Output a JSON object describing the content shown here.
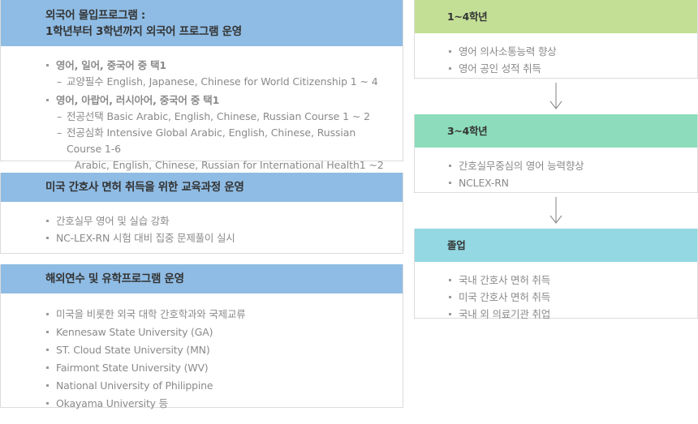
{
  "colors": {
    "left_header_bg": "#8fbce4",
    "grade_1_4_header_bg": "#c3df96",
    "grade_3_4_header_bg": "#8ddcbb",
    "graduation_header_bg": "#93d8e2",
    "body_text": "#8a8a8a",
    "header_text": "#333333",
    "panel_border": "#dcdcdc"
  },
  "left_column": {
    "panels": [
      {
        "title_line_1": "외국어 몰입프로그램 :",
        "title_line_2": "1학년부터 3학년까지 외국어 프로그램 운영",
        "items": [
          {
            "text": "영어, 일어, 중국어 중 택1",
            "bold": true,
            "sub_items": [
              {
                "lines": [
                  "교양필수 English, Japanese, Chinese for World Citizenship 1 ~ 4"
                ]
              }
            ]
          },
          {
            "text": "영어, 아랍어, 러시아어, 중국어 중 택1",
            "bold": true,
            "sub_items": [
              {
                "lines": [
                  "전공선택 Basic Arabic, English, Chinese, Russian Course 1 ~ 2"
                ]
              },
              {
                "lines": [
                  "전공심화 Intensive Global Arabic, English, Chinese, Russian Course 1-6",
                  "Arabic, English, Chinese, Russian for International Health1 ~2"
                ]
              }
            ]
          }
        ]
      },
      {
        "title_line_1": "미국 간호사 면허 취득을 위한 교육과정 운영",
        "title_line_2": "",
        "items": [
          {
            "text": "간호실무 영어 및 실습 강화",
            "bold": false,
            "sub_items": []
          },
          {
            "text": "NC-LEX-RN 시험 대비 집중 문제풀이 실시",
            "bold": false,
            "sub_items": []
          }
        ]
      },
      {
        "title_line_1": "해외연수 및 유학프로그램 운영",
        "title_line_2": "",
        "items": [
          {
            "text": "미국을 비롯한 외국 대학 간호학과와 국제교류",
            "bold": false,
            "sub_items": []
          },
          {
            "text": "Kennesaw State University (GA)",
            "bold": false,
            "sub_items": []
          },
          {
            "text": "ST. Cloud State University (MN)",
            "bold": false,
            "sub_items": []
          },
          {
            "text": "Fairmont State University (WV)",
            "bold": false,
            "sub_items": []
          },
          {
            "text": "National University of Philippine",
            "bold": false,
            "sub_items": []
          },
          {
            "text": "Okayama University 등",
            "bold": false,
            "sub_items": []
          }
        ]
      }
    ]
  },
  "right_column": {
    "panels": [
      {
        "title": "1~4학년",
        "header_style": "hdr-green",
        "items": [
          "영어 의사소통능력 향상",
          "영어 공인 성적 취득"
        ]
      },
      {
        "title": "3~4학년",
        "header_style": "hdr-mint",
        "items": [
          "간호실무중심의 영어 능력향상",
          "NCLEX-RN"
        ]
      },
      {
        "title": "졸업",
        "header_style": "hdr-cyan",
        "items": [
          "국내 간호사 면허 취득",
          "미국 간호사 면허 취득",
          "국내 외 의료기관 취업"
        ]
      }
    ],
    "connectors": [
      {
        "icon": "arrow-down-icon"
      },
      {
        "icon": "arrow-down-icon"
      }
    ]
  }
}
